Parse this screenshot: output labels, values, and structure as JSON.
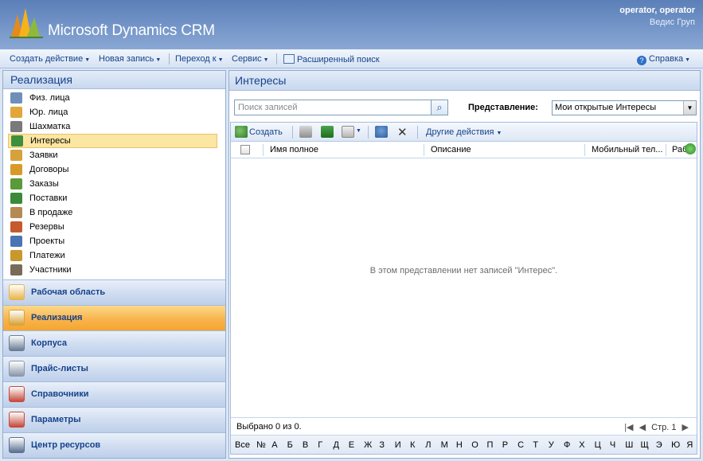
{
  "header": {
    "brand": "Microsoft Dynamics CRM",
    "user_name": "operator, operator",
    "org_name": "Ведис Груп"
  },
  "menubar": {
    "create_action": "Создать действие",
    "new_record": "Новая запись",
    "goto": "Переход к",
    "service": "Сервис",
    "advanced_search": "Расширенный поиск",
    "help": "Справка"
  },
  "leftnav": {
    "title": "Реализация",
    "items": [
      {
        "label": "Физ. лица",
        "color": "#6f8fb8"
      },
      {
        "label": "Юр. лица",
        "color": "#e2a63b"
      },
      {
        "label": "Шахматка",
        "color": "#7a7a7a"
      },
      {
        "label": "Интересы",
        "color": "#3d8f3d"
      },
      {
        "label": "Заявки",
        "color": "#d7a13b"
      },
      {
        "label": "Договоры",
        "color": "#d79a2a"
      },
      {
        "label": "Заказы",
        "color": "#5a9a3a"
      },
      {
        "label": "Поставки",
        "color": "#3a8a3a"
      },
      {
        "label": "В продаже",
        "color": "#b58a52"
      },
      {
        "label": "Резервы",
        "color": "#c55b2d"
      },
      {
        "label": "Проекты",
        "color": "#4a74b2"
      },
      {
        "label": "Платежи",
        "color": "#c8982c"
      },
      {
        "label": "Участники",
        "color": "#7a6a58"
      }
    ],
    "active_index": 3
  },
  "wunderbar": [
    {
      "label": "Рабочая область",
      "color": "#e8b64a"
    },
    {
      "label": "Реализация",
      "color": "#d8a236"
    },
    {
      "label": "Корпуса",
      "color": "#6a7c95"
    },
    {
      "label": "Прайс-листы",
      "color": "#8a97aa"
    },
    {
      "label": "Справочники",
      "color": "#c44a3a"
    },
    {
      "label": "Параметры",
      "color": "#c44a3a"
    },
    {
      "label": "Центр ресурсов",
      "color": "#5a6f8f"
    }
  ],
  "wunderbar_active_index": 1,
  "main": {
    "title": "Интересы",
    "search_placeholder": "Поиск записей",
    "view_label": "Представление:",
    "view_value": "Мои открытые Интересы",
    "toolbar": {
      "create": "Создать",
      "other_actions": "Другие действия"
    },
    "columns": [
      "Имя полное",
      "Описание",
      "Мобильный тел...",
      "Раб"
    ],
    "empty_message": "В этом представлении нет записей \"Интерес\".",
    "status_text": "Выбрано 0 из 0.",
    "page_label": "Стр. 1",
    "alphabet": [
      "Все",
      "№",
      "А",
      "Б",
      "В",
      "Г",
      "Д",
      "Е",
      "Ж",
      "З",
      "И",
      "К",
      "Л",
      "М",
      "Н",
      "О",
      "П",
      "Р",
      "С",
      "Т",
      "У",
      "Ф",
      "Х",
      "Ц",
      "Ч",
      "Ш",
      "Щ",
      "Э",
      "Ю",
      "Я"
    ]
  }
}
